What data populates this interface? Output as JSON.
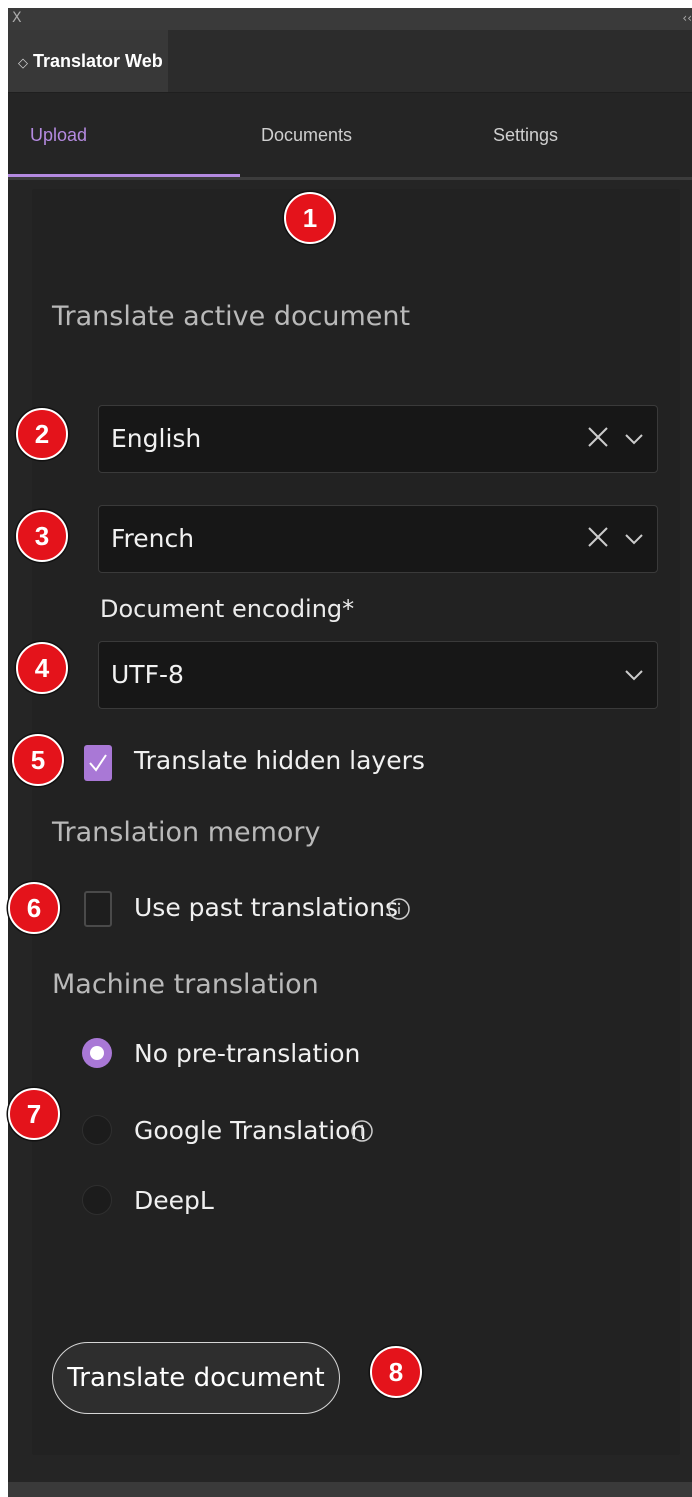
{
  "window": {
    "close_glyph": "X",
    "collapse_glyph": "‹‹",
    "panel_title": "Translator Web",
    "panel_menu_glyph": "◇"
  },
  "nav": {
    "tabs": [
      "Upload",
      "Documents",
      "Settings"
    ],
    "active_tab": "Upload"
  },
  "form": {
    "title": "Translate active document",
    "source_language": "English",
    "target_language": "French",
    "encoding_label": "Document encoding*",
    "encoding_value": "UTF-8",
    "hidden_layers_label": "Translate hidden layers",
    "hidden_layers_checked": true,
    "memory_heading": "Translation memory",
    "past_translations_label": "Use past translations",
    "past_translations_checked": false,
    "machine_heading": "Machine translation",
    "machine_options": [
      "No pre-translation",
      "Google Translation",
      "DeepL"
    ],
    "machine_selected": "No pre-translation",
    "translate_button": "Translate document"
  },
  "markers": [
    "1",
    "2",
    "3",
    "4",
    "5",
    "6",
    "7",
    "8"
  ],
  "colors": {
    "accent": "#b48ae0",
    "marker_red": "#e4131b",
    "panel_bg": "#252525"
  },
  "icons": {
    "clear": "x-icon",
    "dropdown": "chevron-down-icon",
    "info": "info-icon",
    "check": "checkmark-icon"
  }
}
